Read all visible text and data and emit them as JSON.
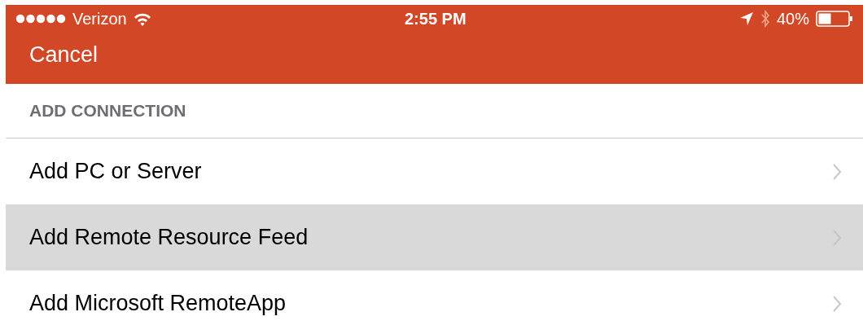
{
  "status_bar": {
    "carrier": "Verizon",
    "time": "2:55 PM",
    "battery": "40%"
  },
  "nav_bar": {
    "cancel": "Cancel"
  },
  "section": {
    "header": "ADD CONNECTION",
    "items": [
      {
        "label": "Add PC or Server",
        "selected": false
      },
      {
        "label": "Add Remote Resource Feed",
        "selected": true
      },
      {
        "label": "Add Microsoft RemoteApp",
        "selected": false
      }
    ]
  }
}
